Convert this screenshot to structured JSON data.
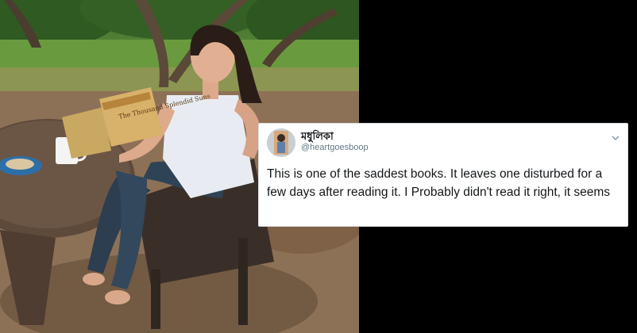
{
  "tweet": {
    "display_name": "মধুলিকা",
    "handle": "@heartgoesboop",
    "text": "This is one of the saddest books. It leaves one disturbed for a few days after reading it. I Probably didn't read it right, it seems"
  },
  "book_cover_text": "The Thousand Splendid Suns",
  "icons": {
    "avatar": "user-avatar",
    "menu": "chevron-down-icon"
  },
  "colors": {
    "background": "#000000",
    "card": "#ffffff",
    "text": "#14171a",
    "handle": "#657786"
  }
}
